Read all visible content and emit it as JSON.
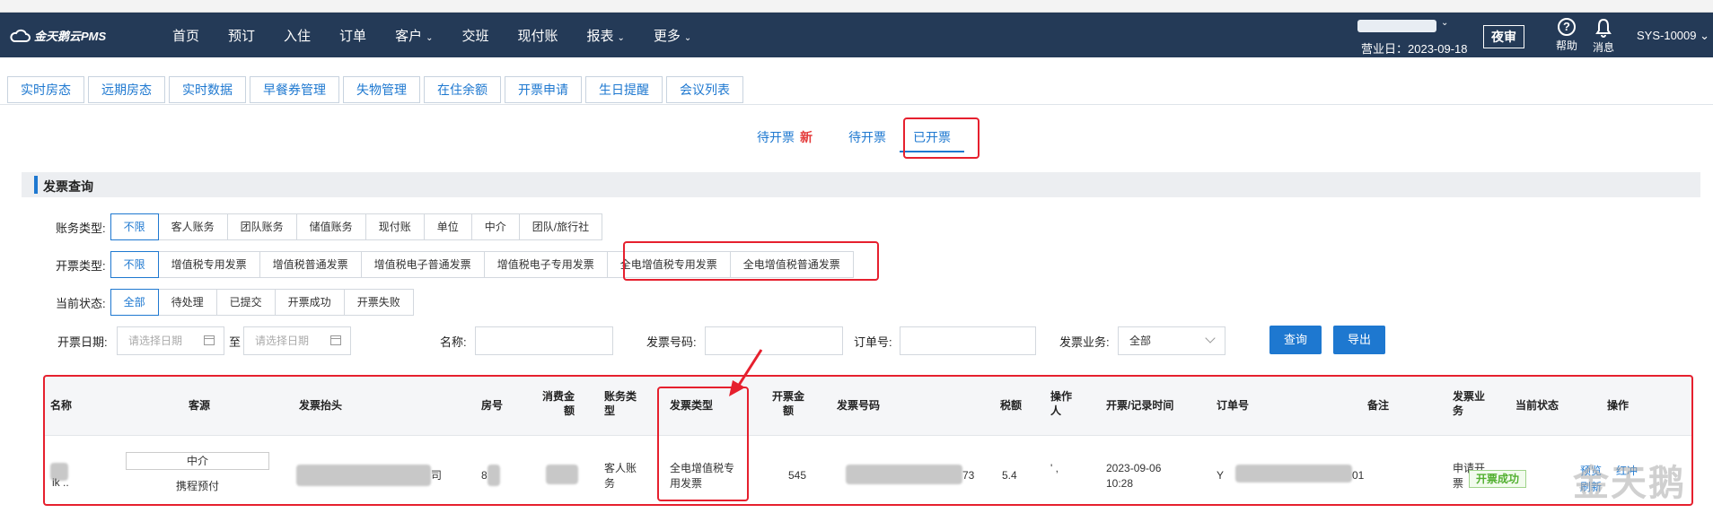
{
  "app": {
    "name": "金天鹅云PMS"
  },
  "nav": [
    {
      "label": "首页",
      "dropdown": false
    },
    {
      "label": "预订",
      "dropdown": false
    },
    {
      "label": "入住",
      "dropdown": false
    },
    {
      "label": "订单",
      "dropdown": false
    },
    {
      "label": "客户",
      "dropdown": true
    },
    {
      "label": "交班",
      "dropdown": false
    },
    {
      "label": "现付账",
      "dropdown": false
    },
    {
      "label": "报表",
      "dropdown": true
    },
    {
      "label": "更多",
      "dropdown": true
    }
  ],
  "header": {
    "business_date": "营业日：2023-09-18",
    "night_audit": "夜审",
    "help": "帮助",
    "messages": "消息",
    "user": "SYS-10009"
  },
  "tabs": [
    "实时房态",
    "远期房态",
    "实时数据",
    "早餐券管理",
    "失物管理",
    "在住余额",
    "开票申请",
    "生日提醒",
    "会议列表"
  ],
  "subtabs": {
    "pending_new": "待开票",
    "new_badge": "新",
    "pending": "待开票",
    "issued": "已开票"
  },
  "section_title": "发票查询",
  "filters": {
    "account_type": {
      "label": "账务类型:",
      "options": [
        "不限",
        "客人账务",
        "团队账务",
        "储值账务",
        "现付账",
        "单位",
        "中介",
        "团队/旅行社"
      ],
      "selected": 0
    },
    "invoice_type": {
      "label": "开票类型:",
      "options": [
        "不限",
        "增值税专用发票",
        "增值税普通发票",
        "增值税电子普通发票",
        "增值税电子专用发票",
        "全电增值税专用发票",
        "全电增值税普通发票"
      ],
      "selected": 0
    },
    "status": {
      "label": "当前状态:",
      "options": [
        "全部",
        "待处理",
        "已提交",
        "开票成功",
        "开票失败"
      ],
      "selected": 0
    },
    "date": {
      "label": "开票日期:",
      "start_placeholder": "请选择日期",
      "to": "至",
      "end_placeholder": "请选择日期"
    },
    "name_label": "名称:",
    "invoice_no_label": "发票号码:",
    "order_no_label": "订单号:",
    "business_label": "发票业务:",
    "business_value": "全部",
    "query_btn": "查询",
    "export_btn": "导出"
  },
  "table": {
    "headers": {
      "name": "名称",
      "source": "客源",
      "title": "发票抬头",
      "room": "房号",
      "amount1": "消费金",
      "amount2": "额",
      "acct1": "账务类",
      "acct2": "型",
      "invtype": "发票类型",
      "issue1": "开票金",
      "issue2": "额",
      "invno": "发票号码",
      "tax": "税额",
      "op1": "操作",
      "op2": "人",
      "time": "开票/记录时间",
      "order": "订单号",
      "remark": "备注",
      "biz1": "发票业",
      "biz2": "务",
      "status": "当前状态",
      "action": "操作"
    },
    "row": {
      "name": "ik ..",
      "source_tag": "中介",
      "source": "携程预付",
      "title_tail": "司",
      "room": "8",
      "acct1": "客人账",
      "acct2": "务",
      "invtype1": "全电增值税专",
      "invtype2": "用发票",
      "issue_amount": "545",
      "invno_tail": "73",
      "tax": "5.4",
      "operator": "' ,",
      "time1": "2023-09-06",
      "time2": "10:28",
      "order_head": "Y",
      "order_tail": "01",
      "biz1": "申请开",
      "biz2": "票",
      "status": "开票成功",
      "action_preview": "预览",
      "action_redflush": "红冲",
      "action_refresh": "刷新"
    }
  },
  "watermark": "金天鹅"
}
